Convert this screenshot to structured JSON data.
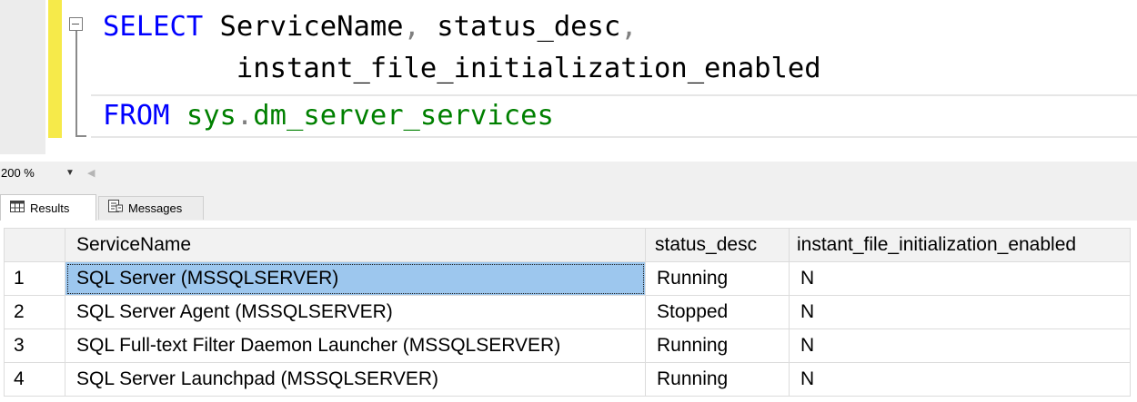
{
  "editor": {
    "lines": [
      {
        "keyword": "SELECT",
        "t1": " ServiceName",
        "c1": ",",
        "t2": " status_desc",
        "c2": ","
      },
      {
        "indent": "        ",
        "text": "instant_file_initialization_enabled"
      },
      {
        "keyword": "FROM",
        "space": " ",
        "schema": "sys",
        "dot": ".",
        "object": "dm_server_services"
      }
    ]
  },
  "zoom": {
    "value": "200 %"
  },
  "tabs": [
    {
      "label": "Results",
      "icon": "grid-icon",
      "active": true
    },
    {
      "label": "Messages",
      "icon": "messages-icon",
      "active": false
    }
  ],
  "results": {
    "columns": [
      "ServiceName",
      "status_desc",
      "instant_file_initialization_enabled"
    ],
    "rows": [
      {
        "num": "1",
        "ServiceName": "SQL Server (MSSQLSERVER)",
        "status_desc": "Running",
        "ifi": "N"
      },
      {
        "num": "2",
        "ServiceName": "SQL Server Agent (MSSQLSERVER)",
        "status_desc": "Stopped",
        "ifi": "N"
      },
      {
        "num": "3",
        "ServiceName": "SQL Full-text Filter Daemon Launcher (MSSQLSERVER)",
        "status_desc": "Running",
        "ifi": "N"
      },
      {
        "num": "4",
        "ServiceName": "SQL Server Launchpad (MSSQLSERVER)",
        "status_desc": "Running",
        "ifi": "N"
      }
    ]
  },
  "colors": {
    "keyword": "#0000ff",
    "system_object": "#008000",
    "punctuation": "#808080",
    "change_bar": "#f6ea4a",
    "selected_cell": "#9dc7ee"
  }
}
